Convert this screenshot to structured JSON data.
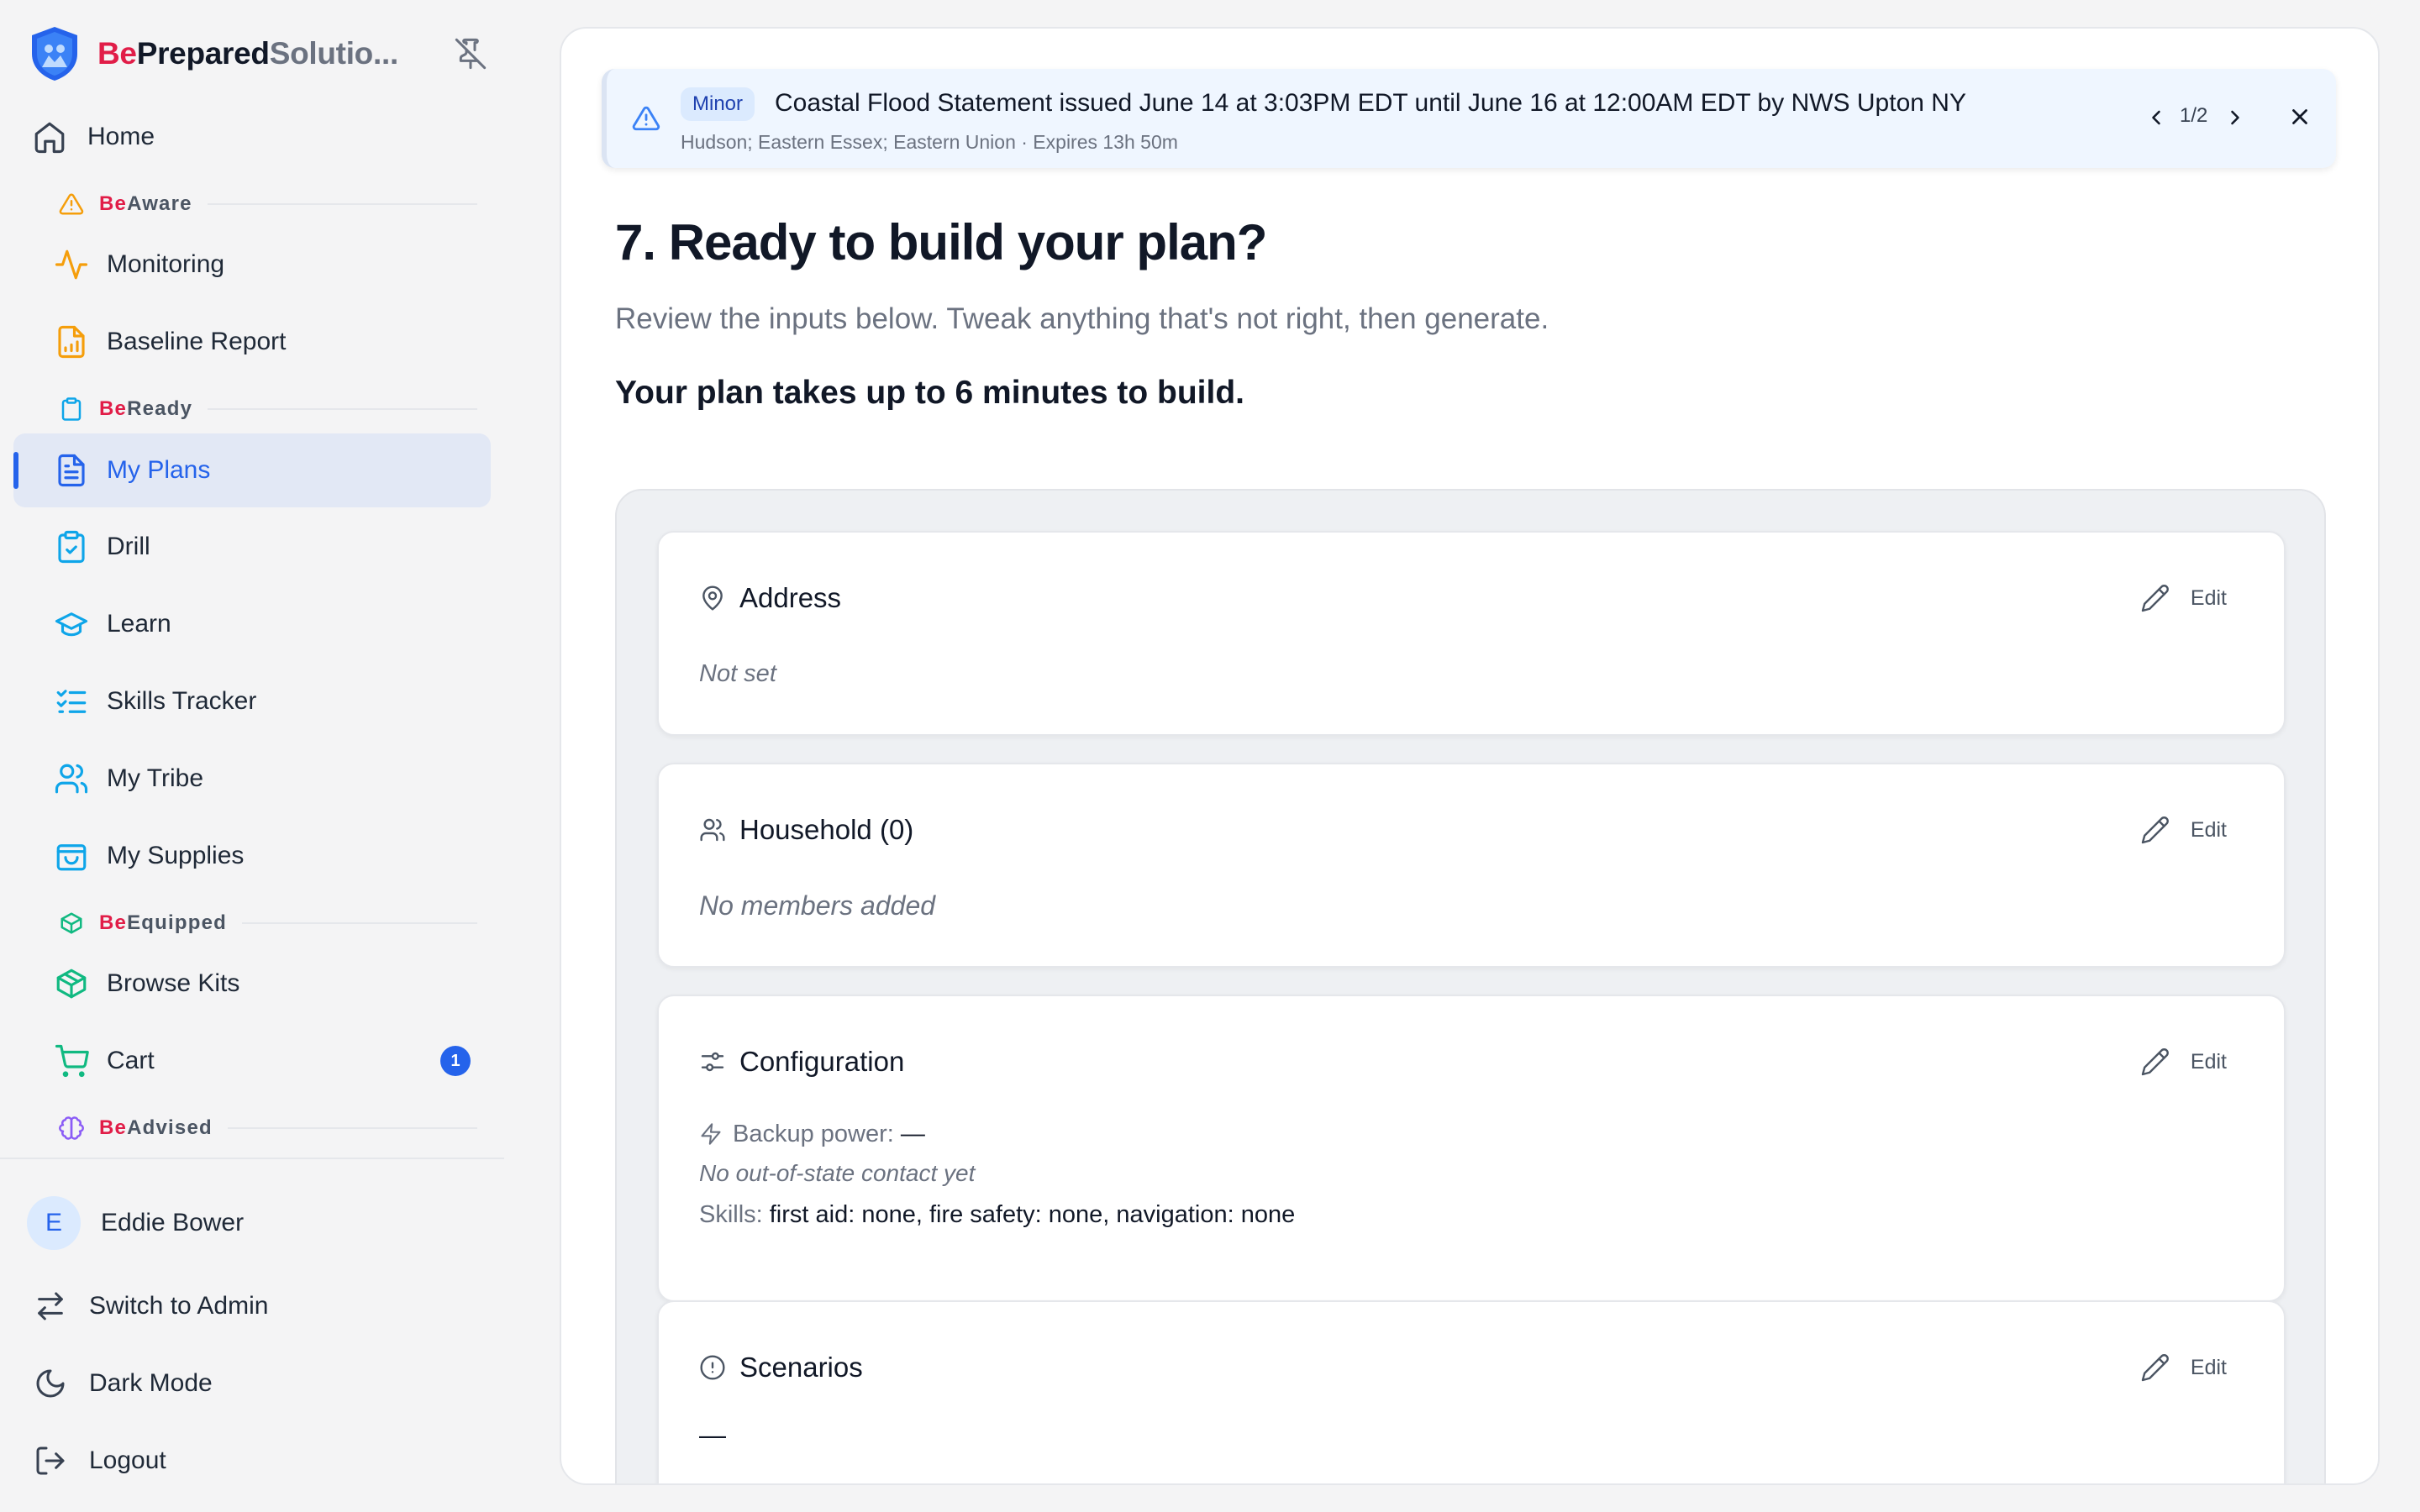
{
  "brand": {
    "be": "Be",
    "prepared": "Prepared",
    "solutions": "Solutio..."
  },
  "nav": {
    "home": "Home",
    "sections": {
      "aware": {
        "be": "Be",
        "rest": "Aware"
      },
      "ready": {
        "be": "Be",
        "rest": "Ready"
      },
      "equipped": {
        "be": "Be",
        "rest": "Equipped"
      },
      "advised": {
        "be": "Be",
        "rest": "Advised"
      }
    },
    "monitoring": "Monitoring",
    "baseline_report": "Baseline Report",
    "my_plans": "My Plans",
    "drill": "Drill",
    "learn": "Learn",
    "skills_tracker": "Skills Tracker",
    "my_tribe": "My Tribe",
    "my_supplies": "My Supplies",
    "browse_kits": "Browse Kits",
    "cart": "Cart",
    "cart_count": "1"
  },
  "user": {
    "initial": "E",
    "name": "Eddie Bower"
  },
  "actions": {
    "switch_admin": "Switch to Admin",
    "dark_mode": "Dark Mode",
    "logout": "Logout"
  },
  "alert": {
    "severity": "Minor",
    "title": "Coastal Flood Statement issued June 14 at 3:03PM EDT until June 16 at 12:00AM EDT by NWS Upton NY",
    "subtitle": "Hudson; Eastern Essex; Eastern Union · Expires 13h 50m",
    "pager": "1/2"
  },
  "page": {
    "title": "7. Ready to build your plan?",
    "subtitle": "Review the inputs below. Tweak anything that's not right, then generate.",
    "note": "Your plan takes up to 6 minutes to build."
  },
  "cards": {
    "edit_label": "Edit",
    "address": {
      "title": "Address",
      "value": "Not set"
    },
    "household": {
      "title": "Household (0)",
      "value": "No members added"
    },
    "configuration": {
      "title": "Configuration",
      "backup_label": "Backup power:",
      "backup_value": "—",
      "contact": "No out-of-state contact yet",
      "skills_label": "Skills:",
      "skills_value": "first aid: none, fire safety: none, navigation: none"
    },
    "scenarios": {
      "title": "Scenarios",
      "value": "—"
    }
  },
  "colors": {
    "brand_red": "#e11d48",
    "accent_blue": "#2563eb",
    "aware_orange": "#f59e0b",
    "ready_sky": "#0ea5e9",
    "equipped_green": "#10b981",
    "advised_purple": "#8b5cf6"
  }
}
